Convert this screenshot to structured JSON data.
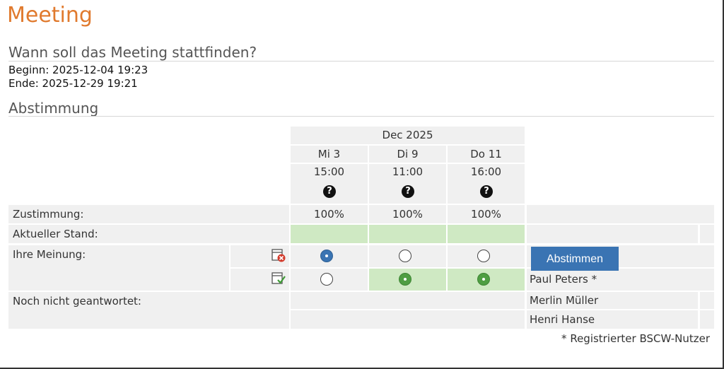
{
  "page_title": "Meeting",
  "when_heading": "Wann soll das Meeting stattfinden?",
  "begin_text": "Beginn: 2025-12-04 19:23",
  "end_text": "Ende: 2025-12-29 19:21",
  "vote_heading": "Abstimmung",
  "table": {
    "month": "Dec 2025",
    "columns": [
      {
        "day": "Mi 3",
        "time": "15:00",
        "agreement": "100%"
      },
      {
        "day": "Di 9",
        "time": "11:00",
        "agreement": "100%"
      },
      {
        "day": "Do 11",
        "time": "16:00",
        "agreement": "100%"
      }
    ],
    "row_labels": {
      "agreement": "Zustimmung:",
      "current": "Aktueller Stand:",
      "your_opinion": "Ihre Meinung:",
      "not_answered": "Noch nicht geantwortet:"
    },
    "participants": [
      "Paul Peters *",
      "Merlin Müller",
      "Henri Hanse"
    ]
  },
  "vote_button_label": "Abstimmen",
  "footnote": "* Registrierter BSCW-Nutzer",
  "help_icon_glyph": "?",
  "colors": {
    "accent": "#e07a2e",
    "button": "#3a74b3",
    "yes_green": "#4f9e43",
    "light_green": "#cfe9c3"
  }
}
